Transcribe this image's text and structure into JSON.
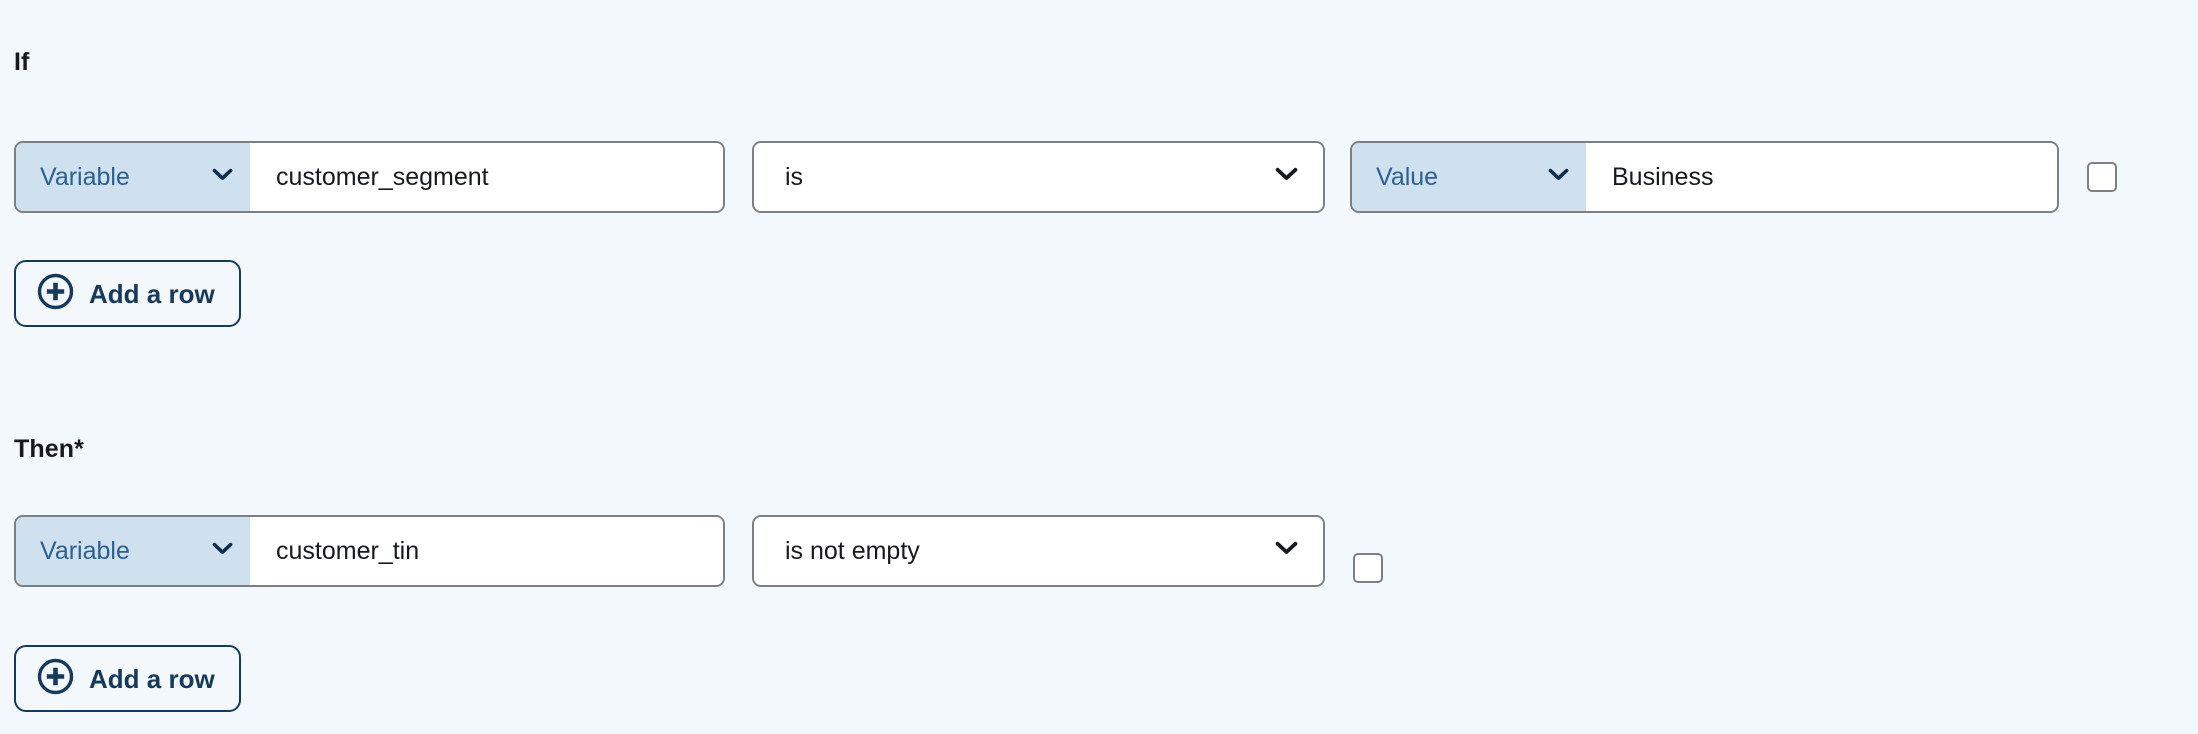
{
  "theme": {
    "page_background": "#f3f8fc",
    "field_border": "#7c8085",
    "prefix_background": "#cfe0ef",
    "prefix_text": "#2a6094",
    "accent_navy": "#16395e",
    "body_text": "#16191d"
  },
  "if_section": {
    "label": "If",
    "rows": [
      {
        "variable_select": {
          "label": "Variable",
          "icon": "chevron-down-icon"
        },
        "variable_input": {
          "value": "customer_segment",
          "placeholder": ""
        },
        "operator_select": {
          "label": "is",
          "icon": "chevron-down-icon"
        },
        "value_select": {
          "label": "Value",
          "icon": "chevron-down-icon"
        },
        "value_input": {
          "value": "Business",
          "placeholder": ""
        },
        "row_checkbox": {
          "checked": false,
          "label": ""
        }
      }
    ],
    "add_row_button": {
      "label": "Add a row",
      "icon": "plus-circle-icon"
    }
  },
  "then_section": {
    "label": "Then*",
    "rows": [
      {
        "variable_select": {
          "label": "Variable",
          "icon": "chevron-down-icon"
        },
        "variable_input": {
          "value": "customer_tin",
          "placeholder": ""
        },
        "operator_select": {
          "label": "is not empty",
          "icon": "chevron-down-icon"
        },
        "row_checkbox": {
          "checked": false,
          "label": ""
        }
      }
    ],
    "add_row_button": {
      "label": "Add a row",
      "icon": "plus-circle-icon"
    }
  }
}
